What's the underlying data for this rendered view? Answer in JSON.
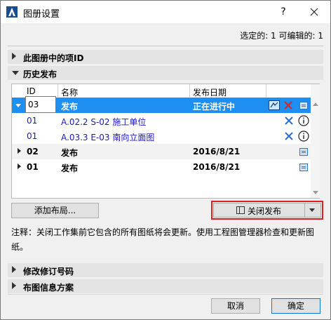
{
  "window": {
    "title": "图册设置",
    "help": "?",
    "close": "✕"
  },
  "selection": {
    "text": "选定的: 1 可编辑的: 1"
  },
  "sections": {
    "ids": "此图册中的项ID",
    "history": "历史发布",
    "revision": "修改修订号码",
    "info_scheme": "布图信息方案"
  },
  "table": {
    "columns": [
      "ID",
      "名称",
      "发布日期"
    ],
    "rows": [
      {
        "id": "03",
        "name": "发布",
        "date": "正在进行中",
        "kind": "selected"
      },
      {
        "id": "01",
        "name": "A.02.2 S-02 施工单位",
        "kind": "sub"
      },
      {
        "id": "01",
        "name": "A.03.3 E-03 南向立面图",
        "kind": "sub"
      },
      {
        "id": "02",
        "name": "发布",
        "date": "2016/8/21",
        "kind": "group"
      },
      {
        "id": "01",
        "name": "发布",
        "date": "2016/8/21",
        "kind": "group"
      }
    ]
  },
  "buttons": {
    "add_layout": "添加布局...",
    "close_release": "关闭发布",
    "cancel": "取消",
    "ok": "确定"
  },
  "note": "注释：关闭工作集前它包含的所有图纸将会更新。使用工程图管理器检查和更新图纸。",
  "colors": {
    "selection": "#1e8ff0",
    "link": "#1a1ab8",
    "highlight_frame": "#e02020"
  }
}
